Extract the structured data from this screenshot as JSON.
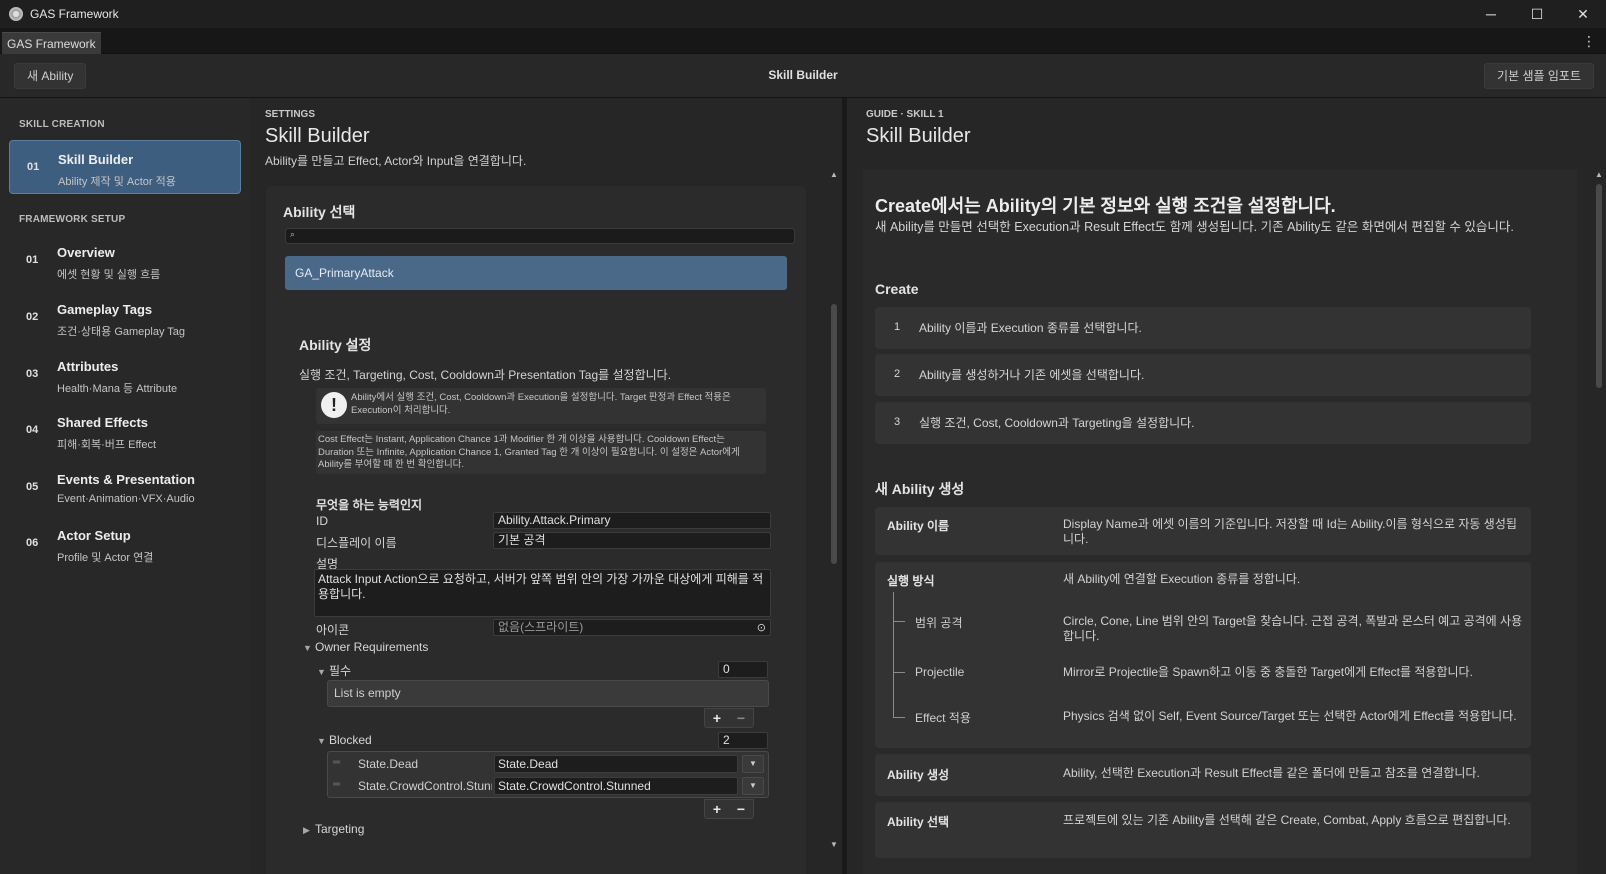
{
  "window": {
    "title": "GAS Framework",
    "controls": [
      "─",
      "☐",
      "✕"
    ]
  },
  "tab": {
    "label": "GAS Framework",
    "menu": "⋮"
  },
  "toolbar": {
    "new_button": "새 Ability",
    "title": "Skill Builder",
    "import_button": "기본 샘플 임포트"
  },
  "sidebar": {
    "section1": "SKILL CREATION",
    "active": {
      "num": "01",
      "label": "Skill Builder",
      "sub": "Ability 제작 및 Actor 적용"
    },
    "section2": "FRAMEWORK SETUP",
    "items": [
      {
        "num": "01",
        "label": "Overview",
        "sub": "에셋 현황 및 실행 흐름"
      },
      {
        "num": "02",
        "label": "Gameplay Tags",
        "sub": "조건·상태용 Gameplay Tag"
      },
      {
        "num": "03",
        "label": "Attributes",
        "sub": "Health·Mana 등 Attribute"
      },
      {
        "num": "04",
        "label": "Shared Effects",
        "sub": "피해·회복·버프 Effect"
      },
      {
        "num": "05",
        "label": "Events & Presentation",
        "sub": "Event·Animation·VFX·Audio"
      },
      {
        "num": "06",
        "label": "Actor Setup",
        "sub": "Profile 및 Actor 연결"
      }
    ]
  },
  "settings": {
    "eyebrow": "SETTINGS",
    "title": "Skill Builder",
    "desc": "Ability를 만들고 Effect, Actor와 Input을 연결합니다.",
    "select_heading": "Ability 선택",
    "search_icon": "🔍",
    "selected_ability": "GA_PrimaryAttack",
    "settings_heading": "Ability 설정",
    "settings_desc": "실행 조건, Targeting, Cost, Cooldown과 Presentation Tag를 설정합니다.",
    "warn_help": "Ability에서 실행 조건, Cost, Cooldown과 Execution을 설정합니다. Target 판정과 Effect 적용은 Execution이 처리합니다.",
    "info_help": "Cost Effect는 Instant, Application Chance 1과 Modifier 한 개 이상을 사용합니다. Cooldown Effect는 Duration 또는 Infinite, Application Chance 1, Granted Tag 한 개 이상이 필요합니다. 이 설정은 Actor에게 Ability를 부여할 때 한 번 확인합니다.",
    "group_title": "무엇을 하는 능력인지",
    "id_label": "ID",
    "id_value": "Ability.Attack.Primary",
    "display_label": "디스플레이 이름",
    "display_value": "기본 공격",
    "desc_label": "설명",
    "desc_value": "Attack Input Action으로 요청하고, 서버가 앞쪽 범위 안의 가장 가까운 대상에게 피해를 적용합니다.",
    "icon_label": "아이콘",
    "icon_value": "없음(스프라이트)",
    "owner_req": "Owner Requirements",
    "required_label": "필수",
    "required_count": "0",
    "list_empty": "List is empty",
    "blocked_label": "Blocked",
    "blocked_count": "2",
    "blocked_items": [
      {
        "label": "State.Dead",
        "value": "State.Dead"
      },
      {
        "label": "State.CrowdControl.Stunned",
        "value": "State.CrowdControl.Stunned"
      }
    ],
    "targeting": "Targeting",
    "plus": "+",
    "minus": "−"
  },
  "guide": {
    "eyebrow": "GUIDE · SKILL 1",
    "title": "Skill Builder",
    "h1": "Create에서는 Ability의 기본 정보와 실행 조건을 설정합니다.",
    "p": "새 Ability를 만들면 선택한 Execution과 Result Effect도 함께 생성됩니다. 기존 Ability도 같은 화면에서 편집할 수 있습니다.",
    "create_heading": "Create",
    "steps": [
      {
        "n": "1",
        "text": "Ability 이름과 Execution 종류를 선택합니다."
      },
      {
        "n": "2",
        "text": "Ability를 생성하거나 기존 에셋을 선택합니다."
      },
      {
        "n": "3",
        "text": "실행 조건, Cost, Cooldown과 Targeting을 설정합니다."
      }
    ],
    "new_heading": "새 Ability 생성",
    "rows": {
      "name_k": "Ability 이름",
      "name_v": "Display Name과 에셋 이름의 기준입니다. 저장할 때 Id는 Ability.이름 형식으로 자동 생성됩니다.",
      "exec_k": "실행 방식",
      "exec_v": "새 Ability에 연결할 Execution 종류를 정합니다.",
      "range_k": "범위 공격",
      "range_v": "Circle, Cone, Line 범위 안의 Target을 찾습니다. 근접 공격, 폭발과 몬스터 예고 공격에 사용합니다.",
      "proj_k": "Projectile",
      "proj_v": "Mirror로 Projectile을 Spawn하고 이동 중 충돌한 Target에게 Effect를 적용합니다.",
      "eff_k": "Effect 적용",
      "eff_v": "Physics 검색 없이 Self, Event Source/Target 또는 선택한 Actor에게 Effect를 적용합니다.",
      "create_k": "Ability 생성",
      "create_v": "Ability, 선택한 Execution과 Result Effect를 같은 폴더에 만들고 참조를 연결합니다.",
      "select_k": "Ability 선택",
      "select_v": "프로젝트에 있는 기존 Ability를 선택해 같은 Create, Combat, Apply 흐름으로 편집합니다."
    }
  }
}
